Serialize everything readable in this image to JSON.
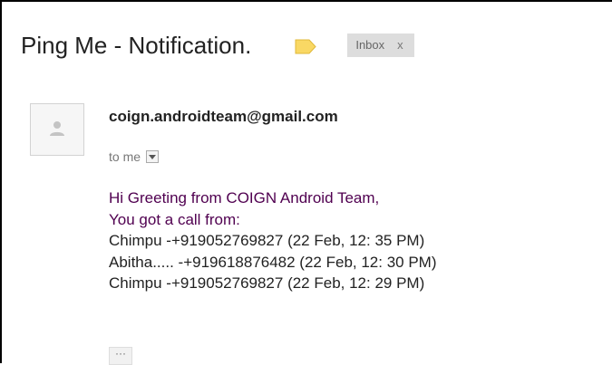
{
  "email": {
    "subject": "Ping Me - Notification.",
    "label_color": "#f9d864",
    "inbox_chip": {
      "label": "Inbox",
      "remove_glyph": "x"
    },
    "sender": {
      "avatar_icon": "person-icon",
      "address": "coign.androidteam@gmail.com"
    },
    "recipient": {
      "text": "to me",
      "dropdown_icon": "chevron-down-icon"
    },
    "body": {
      "greeting": "Hi Greeting from COIGN Android Team,",
      "intro": "You got a call from:",
      "calls": [
        "Chimpu -+919052769827 (22 Feb, 12: 35 PM)",
        "Abitha..... -+919618876482 (22 Feb, 12: 30 PM)",
        "Chimpu -+919052769827 (22 Feb, 12: 29 PM)"
      ]
    },
    "show_trimmed_label": "···"
  }
}
